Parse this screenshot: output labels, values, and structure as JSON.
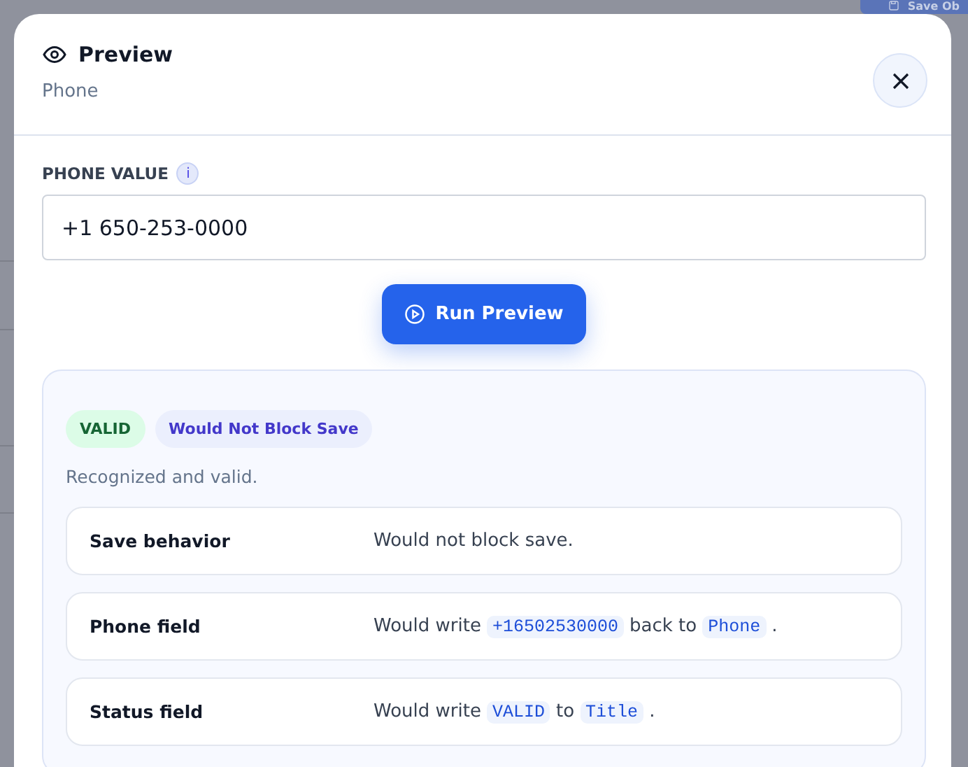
{
  "background": {
    "save_button": "Save Ob"
  },
  "dialog": {
    "title": "Preview",
    "subtitle": "Phone"
  },
  "field": {
    "label": "PHONE VALUE",
    "info": "i",
    "value": "+1 650-253-0000"
  },
  "run_button": "Run Preview",
  "result": {
    "badges": [
      {
        "text": "VALID",
        "kind": "success"
      },
      {
        "text": "Would Not Block Save",
        "kind": "info"
      }
    ],
    "message": "Recognized and valid.",
    "rows": [
      {
        "label": "Save behavior",
        "value": [
          {
            "kind": "text",
            "text": "Would not block save."
          }
        ]
      },
      {
        "label": "Phone field",
        "value": [
          {
            "kind": "text",
            "text": "Would write"
          },
          {
            "kind": "code",
            "text": "+16502530000"
          },
          {
            "kind": "text",
            "text": "back to"
          },
          {
            "kind": "code",
            "text": "Phone"
          },
          {
            "kind": "text",
            "text": "."
          }
        ]
      },
      {
        "label": "Status field",
        "value": [
          {
            "kind": "text",
            "text": "Would write"
          },
          {
            "kind": "code",
            "text": "VALID"
          },
          {
            "kind": "text",
            "text": "to"
          },
          {
            "kind": "code",
            "text": "Title"
          },
          {
            "kind": "text",
            "text": "."
          }
        ]
      }
    ]
  }
}
